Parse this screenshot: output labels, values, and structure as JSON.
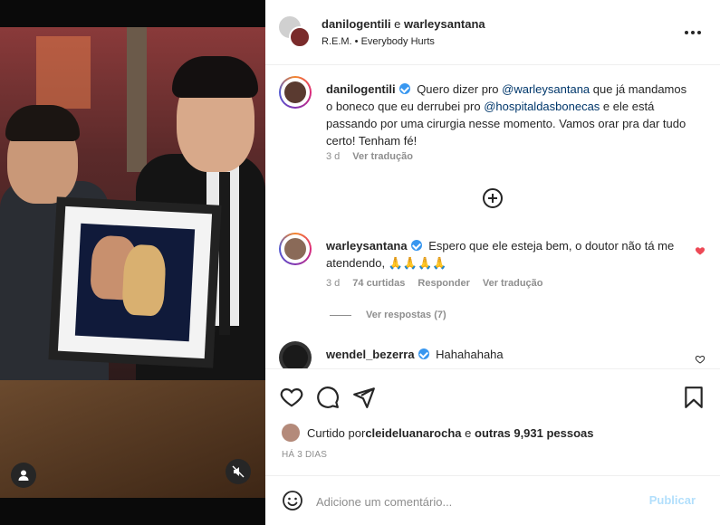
{
  "header": {
    "users": "danilogentili e warleysantana",
    "user_a": "danilogentili",
    "conj": " e ",
    "user_b": "warleysantana",
    "audio": "R.E.M. • Everybody Hurts"
  },
  "comments": [
    {
      "user": "danilogentili",
      "verified": true,
      "text_parts": [
        "Quero dizer pro ",
        "@warleysantana",
        " que já mandamos o boneco que eu derrubei pro ",
        "@hospitaldasbonecas",
        " e ele está passando por uma cirurgia nesse momento. Vamos orar pra dar tudo certo! Tenham fé!"
      ],
      "time": "3 d",
      "translate": "Ver tradução"
    },
    {
      "user": "warleysantana",
      "verified": true,
      "text": "Espero que ele esteja bem, o doutor não tá me atendendo, 🙏🙏🙏🙏",
      "time": "3 d",
      "likes": "74 curtidas",
      "reply": "Responder",
      "translate": "Ver tradução",
      "liked": true
    },
    {
      "user": "wendel_bezerra",
      "verified": true,
      "text": "Hahahahaha"
    }
  ],
  "view_replies": "Ver respostas (7)",
  "likes": {
    "prefix": "Curtido por ",
    "user": "cleideluanarocha",
    "mid": " e ",
    "others": "outras 9,931 pessoas"
  },
  "date": "HÁ 3 DIAS",
  "add_comment": {
    "placeholder": "Adicione um comentário...",
    "publish": "Publicar"
  },
  "colors": {
    "verified": "#3897f0",
    "mention": "#00376b",
    "liked_heart": "#ed4956",
    "publish_disabled": "#b2dffc"
  },
  "icons": [
    "heart-icon",
    "comment-icon",
    "share-icon",
    "bookmark-icon",
    "emoji-icon",
    "plus-circle-icon",
    "more-icon",
    "user-tag-icon",
    "mute-icon"
  ]
}
